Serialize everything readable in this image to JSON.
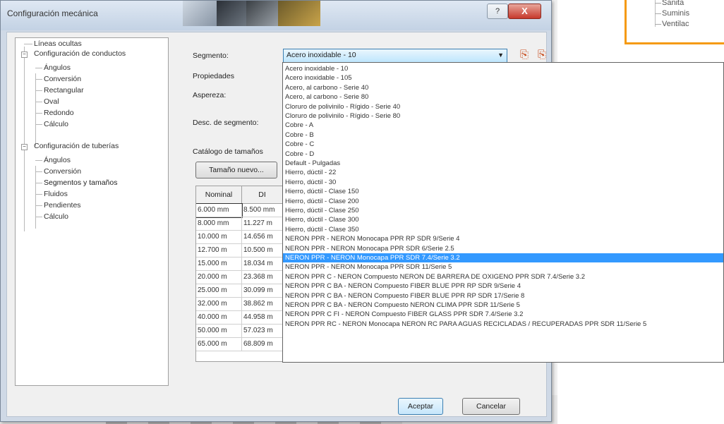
{
  "dialog": {
    "title": "Configuración mecánica",
    "help_label": "?",
    "close_label": "X"
  },
  "background_window": {
    "items": [
      "Sanita",
      "Suminis",
      "Ventilac"
    ]
  },
  "tree": {
    "nodes": [
      {
        "label": "Líneas ocultas"
      },
      {
        "label": "Configuración de conductos"
      },
      {
        "label": "Ángulos"
      },
      {
        "label": "Conversión"
      },
      {
        "label": "Rectangular"
      },
      {
        "label": "Oval"
      },
      {
        "label": "Redondo"
      },
      {
        "label": "Cálculo"
      },
      {
        "label": "Configuración de tuberías"
      },
      {
        "label": "Ángulos"
      },
      {
        "label": "Conversión"
      },
      {
        "label": "Segmentos y tamaños"
      },
      {
        "label": "Fluidos"
      },
      {
        "label": "Pendientes"
      },
      {
        "label": "Cálculo"
      }
    ]
  },
  "form": {
    "segment_label": "Segmento:",
    "segment_value": "Acero inoxidable - 10",
    "properties_label": "Propiedades",
    "roughness_label": "Aspereza:",
    "segment_desc_label": "Desc. de segmento:",
    "catalog_label": "Catálogo de tamaños",
    "new_size_button": "Tamaño nuevo...",
    "accept_button": "Aceptar",
    "cancel_button": "Cancelar"
  },
  "table": {
    "columns": [
      "Nominal",
      "DI"
    ],
    "rows": [
      [
        "6.000 mm",
        "8.500 mm"
      ],
      [
        "8.000 mm",
        "11.227 m"
      ],
      [
        "10.000 m",
        "14.656 m"
      ],
      [
        "12.700 m",
        "10.500 m"
      ],
      [
        "15.000 m",
        "18.034 m"
      ],
      [
        "20.000 m",
        "23.368 m"
      ],
      [
        "25.000 m",
        "30.099 m"
      ],
      [
        "32.000 m",
        "38.862 m"
      ],
      [
        "40.000 m",
        "44.958 m"
      ],
      [
        "50.000 m",
        "57.023 m"
      ],
      [
        "65.000 m",
        "68.809 m"
      ]
    ]
  },
  "dropdown": {
    "highlight_index": 20,
    "items": [
      "Acero inoxidable - 10",
      "Acero inoxidable - 105",
      "Acero, al carbono - Serie 40",
      "Acero, al carbono - Serie 80",
      "Cloruro de polivinilo - Rígido - Serie 40",
      "Cloruro de polivinilo - Rígido - Serie 80",
      "Cobre - A",
      "Cobre - B",
      "Cobre - C",
      "Cobre - D",
      "Default - Pulgadas",
      "Hierro, dúctil - 22",
      "Hierro, dúctil - 30",
      "Hierro, dúctil - Clase 150",
      "Hierro, dúctil - Clase 200",
      "Hierro, dúctil - Clase 250",
      "Hierro, dúctil - Clase 300",
      "Hierro, dúctil - Clase 350",
      "NERON PPR - NERON Monocapa PPR RP SDR 9/Serie 4",
      "NERON PPR - NERON Monocapa PPR SDR 6/Serie 2.5",
      "NERON PPR - NERON Monocapa PPR SDR 7.4/Serie 3.2",
      "NERON PPR - NERON Monocapa PPR SDR 11/Serie 5",
      "NERON PPR C - NERON Compuesto NERON DE BARRERA DE OXIGENO PPR SDR 7.4/Serie 3.2",
      "NERON PPR C BA - NERON Compuesto FIBER BLUE PPR RP SDR 9/Serie 4",
      "NERON PPR C BA - NERON Compuesto FIBER BLUE PPR RP SDR 17/Serie 8",
      "NERON PPR C BA - NERON Compuesto NERON CLIMA PPR SDR 11/Serie 5",
      "NERON PPR C FI - NERON Compuesto FIBER GLASS PPR SDR 7.4/Serie 3.2",
      "NERON PPR RC - NERON Monocapa NERON RC PARA AGUAS RECICLADAS / RECUPERADAS PPR SDR 11/Serie 5"
    ]
  }
}
